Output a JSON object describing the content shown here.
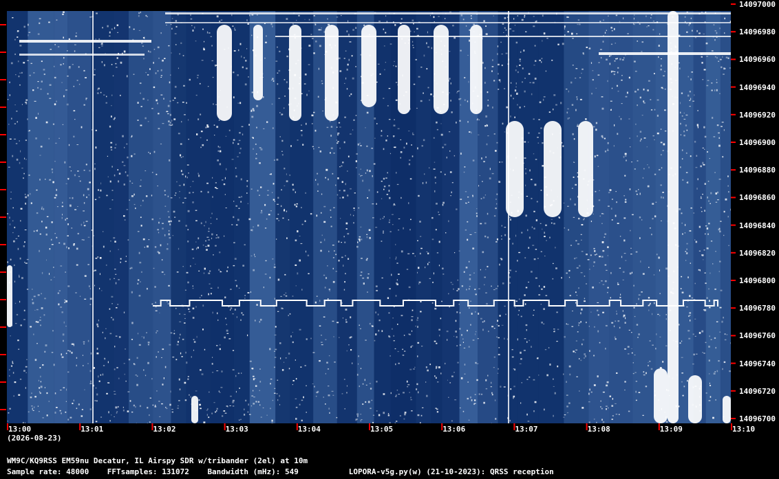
{
  "colors": {
    "background": "#000000",
    "waterfall_base": "#0a2a64",
    "signal": "#ffffff",
    "tick": "#ff0000",
    "text": "#ffffff"
  },
  "y_axis": {
    "labels": [
      "14097000",
      "14096980",
      "14096960",
      "14096940",
      "14096920",
      "14096900",
      "14096880",
      "14096860",
      "14096840",
      "14096820",
      "14096800",
      "14096780",
      "14096760",
      "14096740",
      "14096720",
      "14096700"
    ]
  },
  "x_axis": {
    "labels": [
      "13:00",
      "13:01",
      "13:02",
      "13:03",
      "13:04",
      "13:05",
      "13:06",
      "13:07",
      "13:08",
      "13:09",
      "13:10"
    ],
    "date": "(2026-08-23)"
  },
  "footer": {
    "station": "WM9C/KQ9RSS EM59nu Decatur, IL  Airspy SDR w/tribander (2el) at 10m",
    "sample_rate": "Sample rate: 48000",
    "fft_samples": "FFTsamples: 131072",
    "bandwidth": "Bandwidth (mHz): 549",
    "software": "LOPORA-v5g.py(w) (21-10-2023): QRSS reception"
  }
}
